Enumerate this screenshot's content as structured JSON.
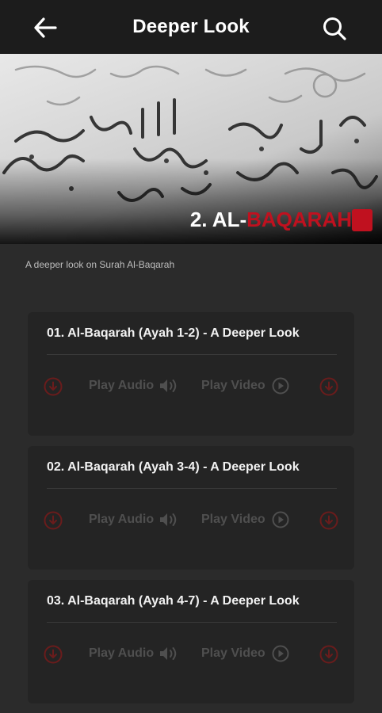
{
  "header": {
    "title": "Deeper Look",
    "back_icon": "arrow-left-icon",
    "search_icon": "search-icon"
  },
  "hero": {
    "surah_number": "2. AL-",
    "surah_name": "BAQARAH",
    "accent_color": "#c0111f"
  },
  "subtitle": "A deeper look on Surah Al-Baqarah",
  "episodes": [
    {
      "title": "01. Al-Baqarah (Ayah 1-2) - A Deeper Look",
      "play_audio_label": "Play Audio",
      "play_video_label": "Play Video"
    },
    {
      "title": "02. Al-Baqarah (Ayah 3-4) - A Deeper Look",
      "play_audio_label": "Play Audio",
      "play_video_label": "Play Video"
    },
    {
      "title": "03. Al-Baqarah (Ayah 4-7) - A Deeper Look",
      "play_audio_label": "Play Audio",
      "play_video_label": "Play Video"
    }
  ],
  "colors": {
    "background": "#2b2b2b",
    "appbar": "#1c1c1c",
    "card": "#242424",
    "disabled_text": "#4f4f4f",
    "download_icon": "#5a1a1a"
  }
}
